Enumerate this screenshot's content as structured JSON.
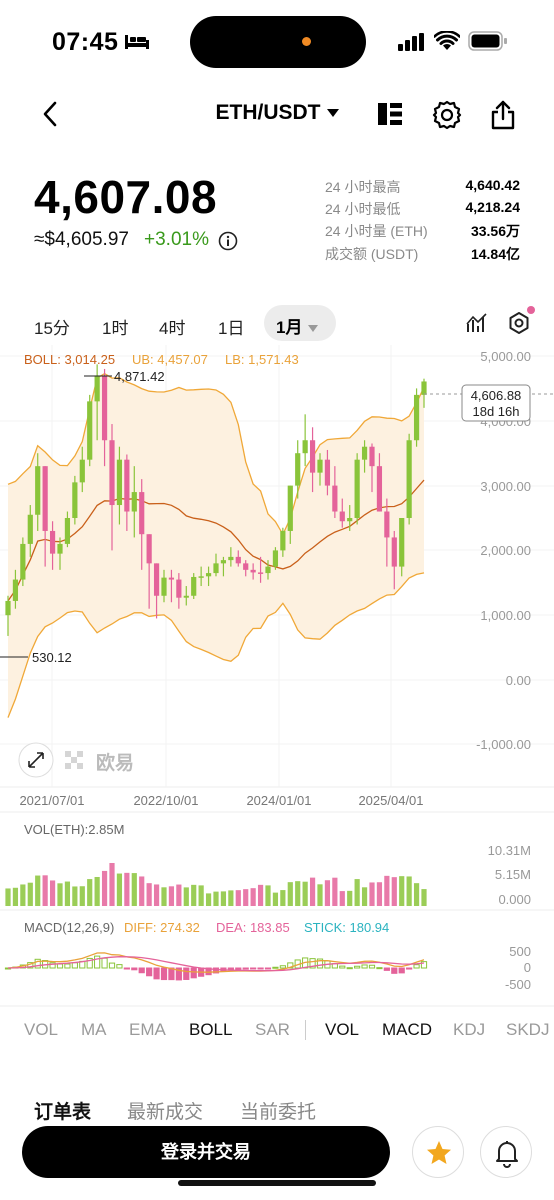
{
  "status": {
    "time": "07:45"
  },
  "header": {
    "pair": "ETH/USDT"
  },
  "price": {
    "last": "4,607.08",
    "fiat": "≈$4,605.97",
    "change": "+3.01%"
  },
  "stats": [
    {
      "label": "24 小时最高",
      "value": "4,640.42"
    },
    {
      "label": "24 小时最低",
      "value": "4,218.24"
    },
    {
      "label": "24 小时量 (ETH)",
      "value": "33.56万"
    },
    {
      "label": "成交额 (USDT)",
      "value": "14.84亿"
    }
  ],
  "timeframes": [
    "15分",
    "1时",
    "4时",
    "1日"
  ],
  "timeframe_selected": "1月",
  "boll": {
    "label": "BOLL: 3,014.25",
    "ub": "UB: 4,457.07",
    "lb": "LB: 1,571.43"
  },
  "chart": {
    "y_ticks": [
      "5,000.00",
      "4,000.00",
      "3,000.00",
      "2,000.00",
      "1,000.00",
      "0.00",
      "-1,000.00"
    ],
    "high_label": "4,871.42",
    "low_label": "530.12",
    "current_price": "4,606.88",
    "countdown": "18d 16h",
    "x_ticks": [
      "2021/07/01",
      "2022/10/01",
      "2024/01/01",
      "2025/04/01"
    ],
    "watermark": "欧易"
  },
  "volume": {
    "label": "VOL(ETH):2.85M",
    "ticks": [
      "10.31M",
      "5.15M",
      "0.000"
    ]
  },
  "macd": {
    "label": "MACD(12,26,9)",
    "diff": "DIFF: 274.32",
    "dea": "DEA: 183.85",
    "stick": "STICK: 180.94",
    "ticks": [
      "500",
      "0",
      "-500"
    ]
  },
  "indicator_tabs": [
    {
      "label": "VOL",
      "active": false
    },
    {
      "label": "MA",
      "active": false
    },
    {
      "label": "EMA",
      "active": false
    },
    {
      "label": "BOLL",
      "active": true
    },
    {
      "label": "SAR",
      "active": false
    },
    {
      "label": "VOL",
      "active": true
    },
    {
      "label": "MACD",
      "active": true
    },
    {
      "label": "KDJ",
      "active": false
    },
    {
      "label": "SKDJ",
      "active": false
    }
  ],
  "order_tabs": [
    {
      "label": "订单表",
      "active": true
    },
    {
      "label": "最新成交",
      "active": false
    },
    {
      "label": "当前委托",
      "active": false
    }
  ],
  "footer": {
    "login_label": "登录并交易"
  },
  "colors": {
    "up": "#8ac43a",
    "down": "#e4639a",
    "mid": "#d9701e",
    "band": "#f0a838",
    "accent_orange": "#f08a24"
  },
  "chart_data": {
    "type": "candlestick",
    "interval": "1M",
    "ohlc": [
      [
        1000,
        1300,
        680,
        1220
      ],
      [
        1220,
        1700,
        1100,
        1550
      ],
      [
        1550,
        2200,
        1450,
        2100
      ],
      [
        2100,
        2700,
        1900,
        2550
      ],
      [
        2550,
        3500,
        2300,
        3300
      ],
      [
        3300,
        2900,
        1750,
        2300
      ],
      [
        2300,
        2450,
        1700,
        1950
      ],
      [
        1950,
        2200,
        1700,
        2100
      ],
      [
        2100,
        2600,
        2050,
        2500
      ],
      [
        2500,
        3150,
        2400,
        3050
      ],
      [
        3050,
        3600,
        2900,
        3400
      ],
      [
        3400,
        4400,
        3300,
        4300
      ],
      [
        4300,
        4871,
        3700,
        4700
      ],
      [
        4700,
        4800,
        3300,
        3700
      ],
      [
        3700,
        3950,
        2000,
        2700
      ],
      [
        2700,
        3600,
        2400,
        3400
      ],
      [
        3400,
        3480,
        2300,
        2600
      ],
      [
        2600,
        3300,
        2200,
        2900
      ],
      [
        2900,
        3100,
        1700,
        2250
      ],
      [
        2250,
        2000,
        1100,
        1800
      ],
      [
        1800,
        1700,
        950,
        1300
      ],
      [
        1300,
        1700,
        1200,
        1580
      ],
      [
        1580,
        1700,
        1200,
        1550
      ],
      [
        1550,
        1650,
        1100,
        1270
      ],
      [
        1270,
        1450,
        1150,
        1300
      ],
      [
        1300,
        1650,
        1250,
        1590
      ],
      [
        1590,
        1750,
        1450,
        1600
      ],
      [
        1600,
        1750,
        1450,
        1650
      ],
      [
        1650,
        1950,
        1600,
        1800
      ],
      [
        1800,
        1900,
        1600,
        1850
      ],
      [
        1850,
        2050,
        1750,
        1900
      ],
      [
        1900,
        2000,
        1750,
        1800
      ],
      [
        1800,
        1850,
        1600,
        1700
      ],
      [
        1700,
        1800,
        1550,
        1660
      ],
      [
        1660,
        1900,
        1500,
        1650
      ],
      [
        1650,
        1850,
        1550,
        1750
      ],
      [
        1750,
        2050,
        1700,
        2000
      ],
      [
        2000,
        2350,
        1900,
        2300
      ],
      [
        2300,
        3000,
        2100,
        3000
      ],
      [
        3000,
        3700,
        2800,
        3500
      ],
      [
        3500,
        4100,
        3300,
        3700
      ],
      [
        3700,
        3900,
        2900,
        3200
      ],
      [
        3200,
        3500,
        3000,
        3400
      ],
      [
        3400,
        3550,
        2850,
        3000
      ],
      [
        3000,
        3300,
        2500,
        2600
      ],
      [
        2600,
        2800,
        2350,
        2450
      ],
      [
        2450,
        2700,
        2300,
        2500
      ],
      [
        2500,
        3500,
        2400,
        3400
      ],
      [
        3400,
        3700,
        3200,
        3600
      ],
      [
        3600,
        3650,
        2900,
        3300
      ],
      [
        3300,
        3500,
        2800,
        2600
      ],
      [
        2600,
        2800,
        1750,
        2200
      ],
      [
        2200,
        2300,
        1400,
        1750
      ],
      [
        1750,
        2500,
        1600,
        2500
      ],
      [
        2500,
        3800,
        2400,
        3700
      ],
      [
        3700,
        4500,
        3600,
        4400
      ],
      [
        4400,
        4650,
        4200,
        4607
      ]
    ]
  }
}
